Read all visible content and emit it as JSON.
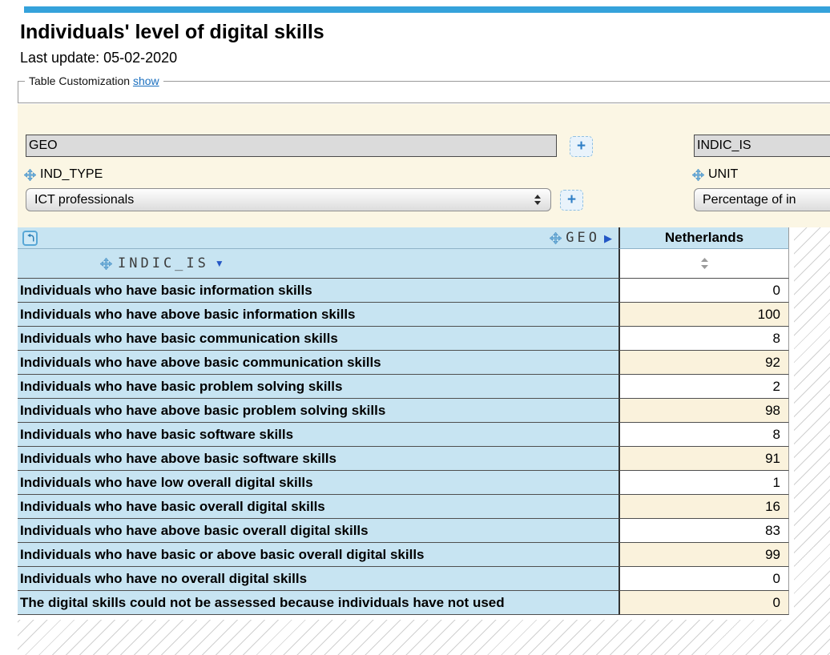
{
  "page": {
    "title": "Individuals' level of digital skills",
    "last_update": "Last update: 05-02-2020"
  },
  "customization": {
    "legend": "Table Customization",
    "show_link": "show"
  },
  "dimensions": {
    "geo_box": "GEO",
    "indic_is_box": "INDIC_IS",
    "ind_type_label": "IND_TYPE",
    "unit_label": "UNIT",
    "ind_type_selected": "ICT professionals",
    "unit_selected": "Percentage of in",
    "add_button": "+"
  },
  "icons": {
    "expand_right": "▶",
    "sort_down": "▼"
  },
  "table": {
    "col_dimension": "GEO",
    "row_dimension": "INDIC_IS",
    "column_header": "Netherlands",
    "rows": [
      {
        "label": "Individuals who have basic information skills",
        "value": "0"
      },
      {
        "label": "Individuals who have above basic information skills",
        "value": "100"
      },
      {
        "label": "Individuals who have basic communication skills",
        "value": "8"
      },
      {
        "label": "Individuals who have above basic communication skills",
        "value": "92"
      },
      {
        "label": "Individuals who have basic problem solving skills",
        "value": "2"
      },
      {
        "label": "Individuals who have above basic problem solving skills",
        "value": "98"
      },
      {
        "label": "Individuals who have basic software skills",
        "value": "8"
      },
      {
        "label": "Individuals who have above basic software skills",
        "value": "91"
      },
      {
        "label": "Individuals who have low overall digital skills",
        "value": "1"
      },
      {
        "label": "Individuals who have basic overall digital skills",
        "value": "16"
      },
      {
        "label": "Individuals who have above basic overall digital skills",
        "value": "83"
      },
      {
        "label": "Individuals who have basic or above basic overall digital skills",
        "value": "99"
      },
      {
        "label": "Individuals who have no overall digital skills",
        "value": "0"
      },
      {
        "label": "The digital skills could not be assessed because individuals have not used",
        "value": "0"
      }
    ]
  },
  "colors": {
    "accent_bar": "#35a2db",
    "header_blue": "#c7e4f2",
    "alt_row_cream": "#faf2dc",
    "link_blue": "#1a6fbf",
    "plus_blue": "#2f7fc6"
  }
}
